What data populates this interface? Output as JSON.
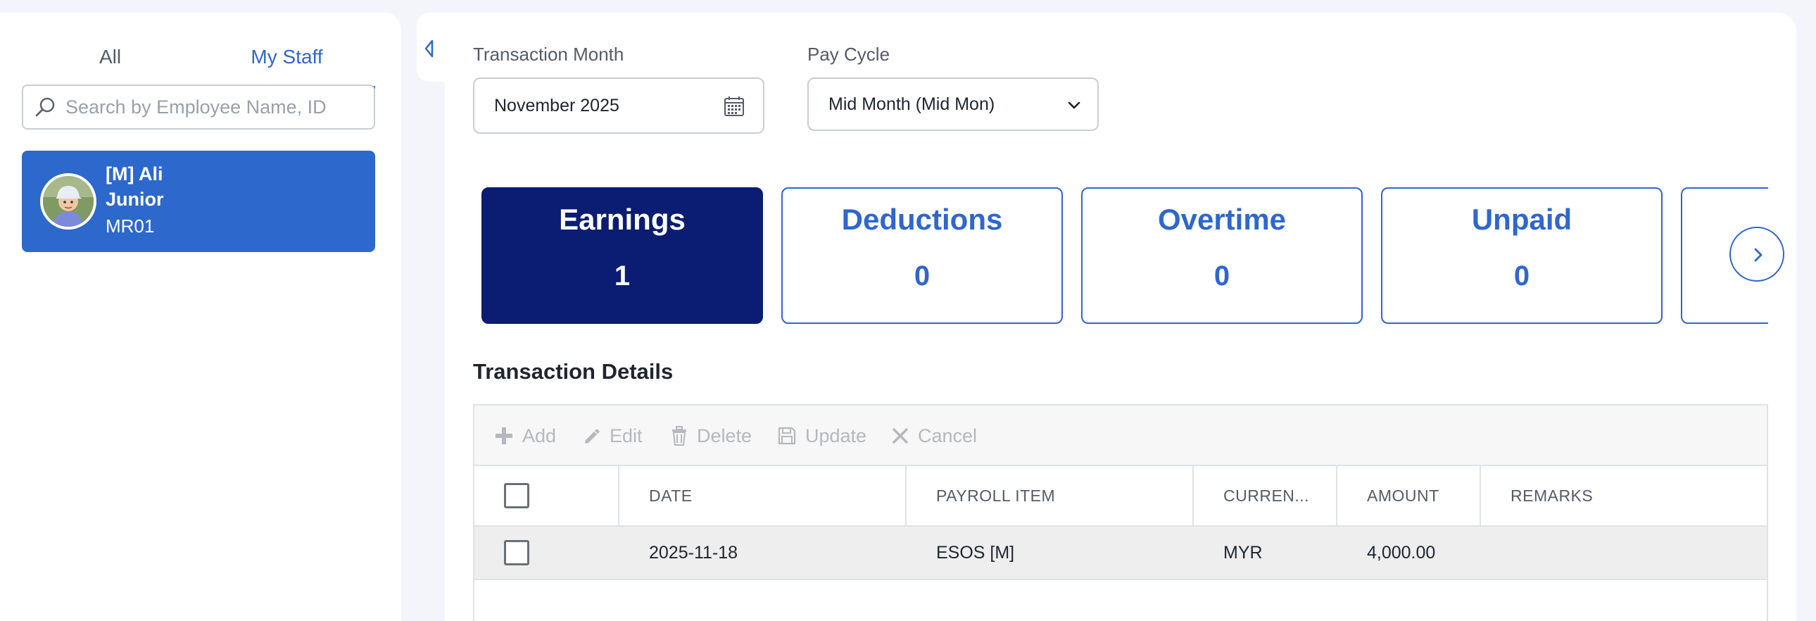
{
  "sidebar": {
    "tabs": [
      {
        "label": "All"
      },
      {
        "label": "My Staff",
        "active": true
      }
    ],
    "search": {
      "placeholder": "Search by Employee Name, ID",
      "value": ""
    },
    "staff": [
      {
        "name": "[M] Ali",
        "role": "Junior",
        "id": "MR01",
        "selected": true
      }
    ]
  },
  "filters": {
    "month_label": "Transaction Month",
    "month_value": "November 2025",
    "cycle_label": "Pay Cycle",
    "cycle_value": "Mid Month (Mid Mon)"
  },
  "summary_cards": [
    {
      "title": "Earnings",
      "count": "1",
      "active": true
    },
    {
      "title": "Deductions",
      "count": "0"
    },
    {
      "title": "Overtime",
      "count": "0"
    },
    {
      "title": "Unpaid",
      "count": "0"
    }
  ],
  "details": {
    "title": "Transaction Details",
    "toolbar": {
      "add": "Add",
      "edit": "Edit",
      "delete": "Delete",
      "update": "Update",
      "cancel": "Cancel"
    },
    "columns": {
      "date": "DATE",
      "payroll_item": "PAYROLL ITEM",
      "currency": "CURREN...",
      "amount": "AMOUNT",
      "remarks": "REMARKS"
    },
    "rows": [
      {
        "date": "2025-11-18",
        "payroll_item": "ESOS [M]",
        "currency": "MYR",
        "amount": "4,000.00",
        "remarks": ""
      }
    ]
  },
  "colors": {
    "accent": "#2f66cf",
    "active_card": "#0b1d72",
    "selected_staff": "#2d69cc"
  }
}
